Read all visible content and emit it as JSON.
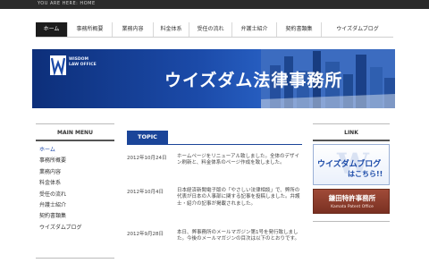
{
  "topbar": {
    "text": "YOU ARE HERE: HOME"
  },
  "nav": {
    "items": [
      {
        "label": "ホーム",
        "active": true
      },
      {
        "label": "事務所概要",
        "active": false
      },
      {
        "label": "業務内容",
        "active": false
      },
      {
        "label": "料金体系",
        "active": false
      },
      {
        "label": "受任の流れ",
        "active": false
      },
      {
        "label": "弁護士紹介",
        "active": false
      },
      {
        "label": "契約書類集",
        "active": false
      },
      {
        "label": "ウイズダムブログ",
        "active": false
      }
    ]
  },
  "banner": {
    "logo_sub_line1": "WISDOM",
    "logo_sub_line2": "LAW OFFICE",
    "firm_name": "ウイズダム法律事務所"
  },
  "menu": {
    "title": "MAIN MENU",
    "items": [
      {
        "label": "ホーム",
        "active": true
      },
      {
        "label": "事務所概要",
        "active": false
      },
      {
        "label": "業務内容",
        "active": false
      },
      {
        "label": "料金体系",
        "active": false
      },
      {
        "label": "受任の流れ",
        "active": false
      },
      {
        "label": "弁護士紹介",
        "active": false
      },
      {
        "label": "契約書類集",
        "active": false
      },
      {
        "label": "ウイズダムブログ",
        "active": false
      }
    ]
  },
  "topic": {
    "tab_label": "TOPIC",
    "entries": [
      {
        "date": "2012年10月24日",
        "text": "ホームページをリニューアル致しました。全体のデザイン刷新と、料金体系のページ作成を致しました。"
      },
      {
        "date": "2012年10月4日",
        "text": "日本経済新聞電子版の「やさしい法律相談」で、弊所の代表が日本の人事部に関する記事を投稿しました。弁護士・紹介の記事が掲載されました。"
      },
      {
        "date": "2012年9月28日",
        "text": "本日、弊事務所のメールマガジン第1号を発行致しました。今後のメールマガジンの目次は以下のとおりです。"
      }
    ]
  },
  "links": {
    "title": "LINK",
    "blog_line1": "ウイズダムブログ",
    "blog_line2": "はこちら!!",
    "patent_name": "鎌田特許事務所",
    "patent_sub": "Kamata Patent Office"
  },
  "colors": {
    "accent": "#1b4599",
    "nav_active": "#1c1c1c",
    "topbar": "#2b2b2b",
    "patent": "#8a3a2a"
  }
}
